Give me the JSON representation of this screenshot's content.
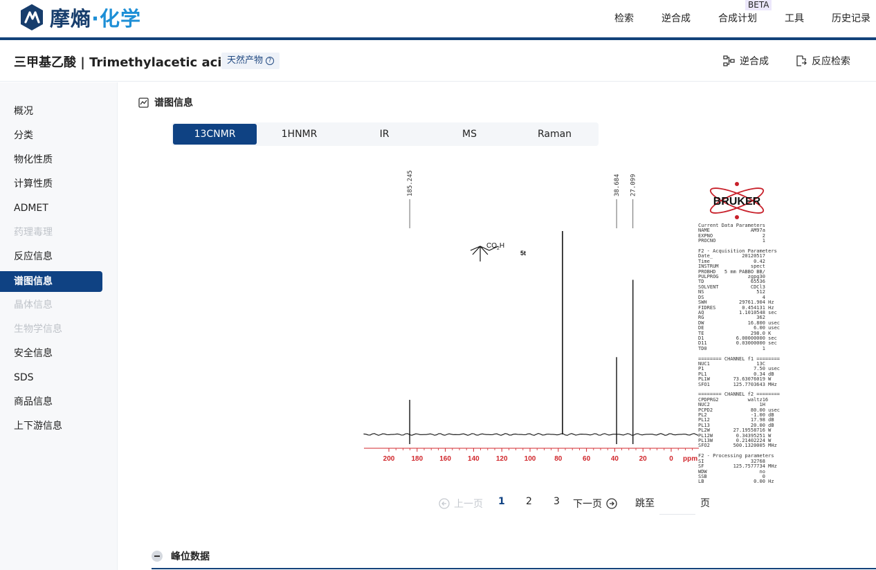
{
  "brand": {
    "name_part1": "摩熵",
    "name_dot": "·",
    "name_part2": "化学"
  },
  "nav": {
    "items": [
      {
        "label": "检索"
      },
      {
        "label": "逆合成"
      },
      {
        "label": "合成计划"
      },
      {
        "label": "工具"
      },
      {
        "label": "历史记录"
      }
    ],
    "beta_badge": "BETA"
  },
  "compound": {
    "title": "三甲基乙酸 | Trimethylacetic acid",
    "badge": "天然产物",
    "help_glyph": "?",
    "actions": [
      {
        "label": "逆合成",
        "icon": "retrosynthesis-icon"
      },
      {
        "label": "反应检索",
        "icon": "reaction-search-icon"
      }
    ]
  },
  "sidebar": {
    "items": [
      {
        "label": "概况",
        "state": "normal"
      },
      {
        "label": "分类",
        "state": "normal"
      },
      {
        "label": "物化性质",
        "state": "normal"
      },
      {
        "label": "计算性质",
        "state": "normal"
      },
      {
        "label": "ADMET",
        "state": "normal"
      },
      {
        "label": "药理毒理",
        "state": "disabled"
      },
      {
        "label": "反应信息",
        "state": "normal"
      },
      {
        "label": "谱图信息",
        "state": "active"
      },
      {
        "label": "晶体信息",
        "state": "disabled"
      },
      {
        "label": "生物学信息",
        "state": "disabled"
      },
      {
        "label": "安全信息",
        "state": "normal"
      },
      {
        "label": "SDS",
        "state": "normal"
      },
      {
        "label": "商品信息",
        "state": "normal"
      },
      {
        "label": "上下游信息",
        "state": "normal"
      }
    ]
  },
  "spectra": {
    "section_title": "谱图信息",
    "tabs": [
      {
        "label": "13CNMR",
        "active": true
      },
      {
        "label": "1HNMR",
        "active": false
      },
      {
        "label": "IR",
        "active": false
      },
      {
        "label": "MS",
        "active": false
      },
      {
        "label": "Raman",
        "active": false
      }
    ],
    "image": {
      "structure_label": "CO₂H",
      "structure_label_main": "CO",
      "structure_label_sub": "2",
      "structure_label_end": "H",
      "compound_code": "5t",
      "axis_unit": "ppm",
      "axis_ticks": [
        "200",
        "180",
        "160",
        "140",
        "120",
        "100",
        "80",
        "60",
        "40",
        "20",
        "0"
      ],
      "peaks": [
        {
          "label": "185.245",
          "ppm": 185.245,
          "rel_height": 0.17
        },
        {
          "label": "38.684",
          "ppm": 38.684,
          "rel_height": 0.38
        },
        {
          "label": "27.099",
          "ppm": 27.099,
          "rel_height": 0.76
        }
      ],
      "solvent_peak": {
        "ppm": 77.0,
        "rel_height": 1.0
      },
      "vendor_logo_text": "BRUKER",
      "params": [
        "Current Data Parameters",
        "NAME              AM97a",
        "EXPNO                 2",
        "PROCNO                1",
        "",
        "F2 - Acquisition Parameters",
        "Date_          20120517",
        "Time               0.42",
        "INSTRUM           spect",
        "PROBHD   5 mm PABBO BB/",
        "PULPROG          zgpg30",
        "TD                65536",
        "SOLVENT           CDCl3",
        "NS                  512",
        "DS                    4",
        "SWH           29761.904 Hz",
        "FIDRES         0.454131 Hz",
        "AQ            1.1010548 sec",
        "RG                  362",
        "DW               16.800 usec",
        "DE                 6.00 usec",
        "TE                298.0 K",
        "D1           6.00000000 sec",
        "D11          0.03000000 sec",
        "TD0                   1",
        "",
        "======== CHANNEL f1 ========",
        "NUC1                13C",
        "P1                 7.50 usec",
        "PL1                0.34 dB",
        "PL1W        73.63076019 W",
        "SFO1        125.7703643 MHz",
        "",
        "======== CHANNEL f2 ========",
        "CPDPRG2          waltz16",
        "NUC2                 1H",
        "PCPD2             80.00 usec",
        "PL2               -1.00 dB",
        "PL12              17.98 dB",
        "PL13              20.00 dB",
        "PL2W        27.19558716 W",
        "PL12W        0.34395251 W",
        "PL13W        0.21402224 W",
        "SFO2        500.1320005 MHz",
        "",
        "F2 - Processing parameters",
        "SI                32768",
        "SF          125.7577734 MHz",
        "WDW                  no",
        "SSB                   0",
        "LB                 0.00 Hz"
      ]
    }
  },
  "pagination": {
    "prev": "上一页",
    "pages": [
      "1",
      "2",
      "3"
    ],
    "current": "1",
    "next": "下一页",
    "jump_label": "跳至",
    "jump_suffix": "页",
    "jump_value": ""
  },
  "peak_section": {
    "title": "峰位数据"
  },
  "colors": {
    "brand_navy": "#0f4283",
    "brand_light": "#1e8fd6",
    "axis_red": "#d0262b"
  }
}
